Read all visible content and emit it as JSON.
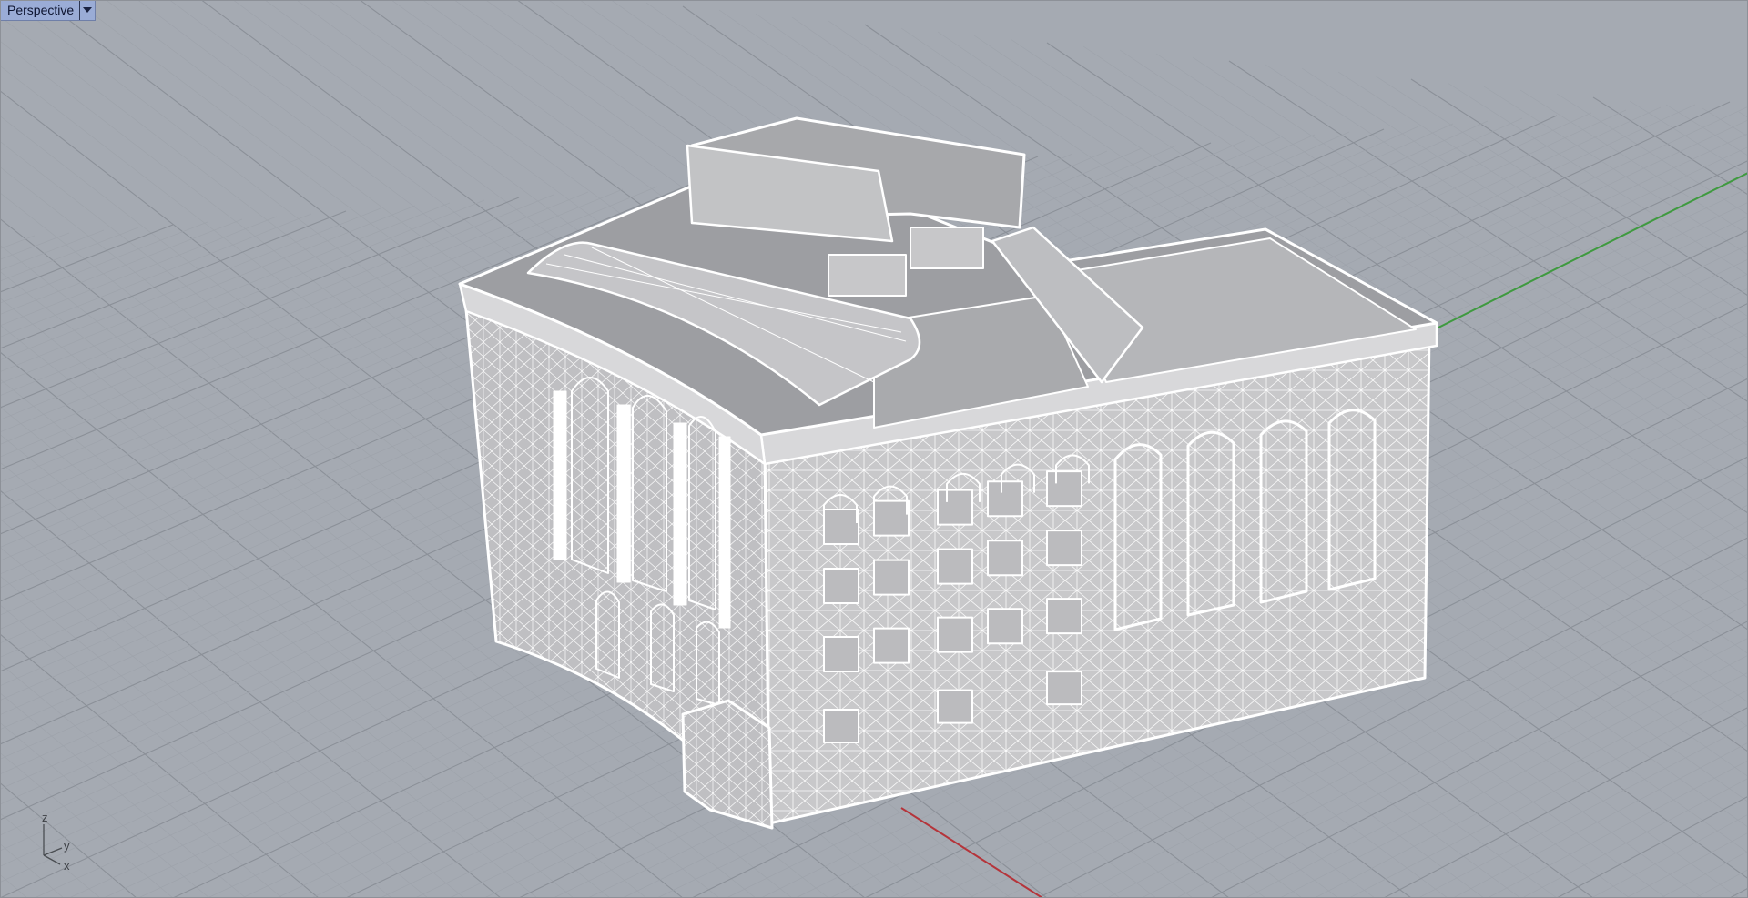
{
  "viewport": {
    "name": "Perspective",
    "dropdown_icon": "chevron-down-icon"
  },
  "axes_widget": {
    "z_label": "z",
    "y_label": "y",
    "x_label": "x"
  },
  "colors": {
    "background": "#a5aab2",
    "grid_minor": "#9ea3ab",
    "grid_major": "#8b9098",
    "x_axis": "#b5343a",
    "y_axis": "#3f9a3f",
    "mesh_face": "#c9c9cb",
    "mesh_edge": "#ffffff"
  }
}
